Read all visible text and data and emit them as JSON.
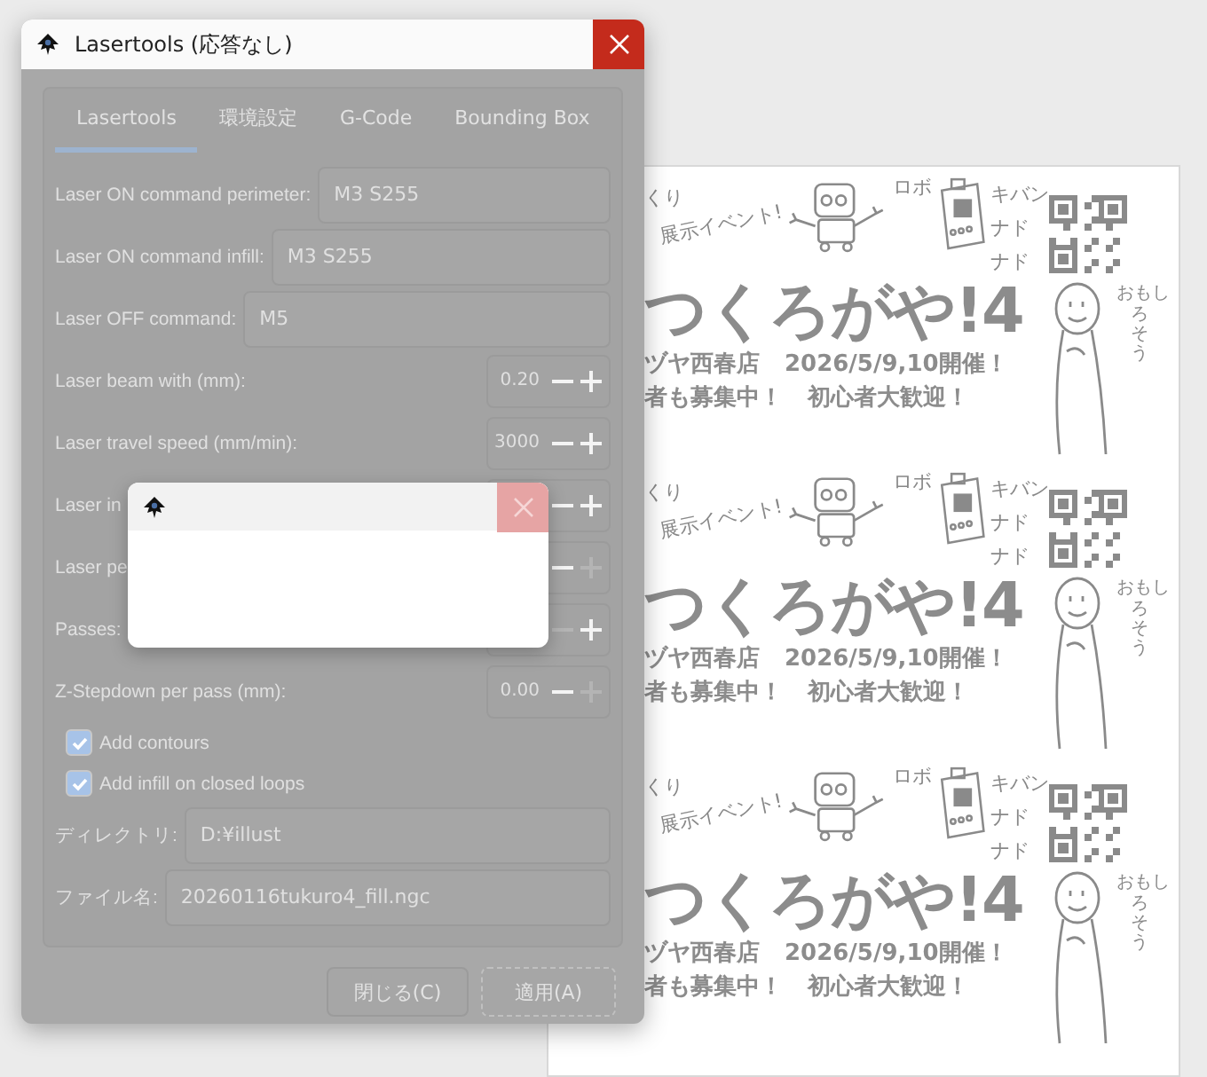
{
  "dialog": {
    "title": "Lasertools (応答なし)",
    "tabs": [
      {
        "label": "Lasertools",
        "selected": true
      },
      {
        "label": "環境設定",
        "selected": false
      },
      {
        "label": "G-Code",
        "selected": false
      },
      {
        "label": "Bounding Box",
        "selected": false
      }
    ],
    "rows": [
      {
        "kind": "text",
        "label": "Laser ON command perimeter:",
        "value": "M3 S255"
      },
      {
        "kind": "text",
        "label": "Laser ON command infill:",
        "value": "M3 S255"
      },
      {
        "kind": "text",
        "label": "Laser OFF command:",
        "value": "M5"
      },
      {
        "kind": "spin",
        "label": "Laser beam with (mm):",
        "value": "0.20",
        "minus_disabled": false,
        "plus_disabled": false
      },
      {
        "kind": "spin",
        "label": "Laser travel speed (mm/min):",
        "value": "3000",
        "minus_disabled": false,
        "plus_disabled": false
      },
      {
        "kind": "spin",
        "label": "Laser in",
        "minus_disabled": false,
        "plus_disabled": false
      },
      {
        "kind": "spin",
        "label": "Laser pe",
        "minus_disabled": false,
        "plus_disabled": true
      },
      {
        "kind": "spin",
        "label": "Passes:",
        "minus_disabled": true,
        "plus_disabled": false
      },
      {
        "kind": "spin",
        "label": "Z-Stepdown per pass (mm):",
        "value": "0.00",
        "minus_disabled": false,
        "plus_disabled": true
      },
      {
        "kind": "check",
        "label": "Add contours",
        "checked": true
      },
      {
        "kind": "check",
        "label": "Add infill on closed loops",
        "checked": true
      },
      {
        "kind": "text",
        "label": "ディレクトリ:",
        "value": "D:¥illust"
      },
      {
        "kind": "text",
        "label": "ファイル名:",
        "value": "20260116tukuro4_fill.ngc"
      }
    ],
    "buttons": [
      "閉じる(C)",
      "適用(A)"
    ]
  },
  "flyers": [
    {
      "scribble": [
        "くり",
        "展示イベント!"
      ],
      "robot_label": "ロボ",
      "board_label": "キバン",
      "etc": [
        "ナド",
        "ナド"
      ],
      "title": "つくろがや!4",
      "line_1": [
        "ヅヤ西春店",
        "2026/5/9,10開催！"
      ],
      "line_2": [
        "者も募集中！",
        "初心者大歓迎！"
      ],
      "comment": [
        "おもし",
        "ろそう"
      ]
    },
    {
      "scribble": [
        "くり",
        "展示イベント!"
      ],
      "robot_label": "ロボ",
      "board_label": "キバン",
      "etc": [
        "ナド",
        "ナド"
      ],
      "title": "つくろがや!4",
      "line_1": [
        "ヅヤ西春店",
        "2026/5/9,10開催！"
      ],
      "line_2": [
        "者も募集中！",
        "初心者大歓迎！"
      ],
      "comment": [
        "おもし",
        "ろそう"
      ]
    },
    {
      "scribble": [
        "くり",
        "展示イベント!"
      ],
      "robot_label": "ロボ",
      "board_label": "キバン",
      "etc": [
        "ナド",
        "ナド"
      ],
      "title": "つくろがや!4",
      "line_1": [
        "ヅヤ西春店",
        "2026/5/9,10開催！"
      ],
      "line_2": [
        "者も募集中！",
        "初心者大歓迎！"
      ],
      "comment": [
        "おもし",
        "ろそう"
      ]
    }
  ]
}
